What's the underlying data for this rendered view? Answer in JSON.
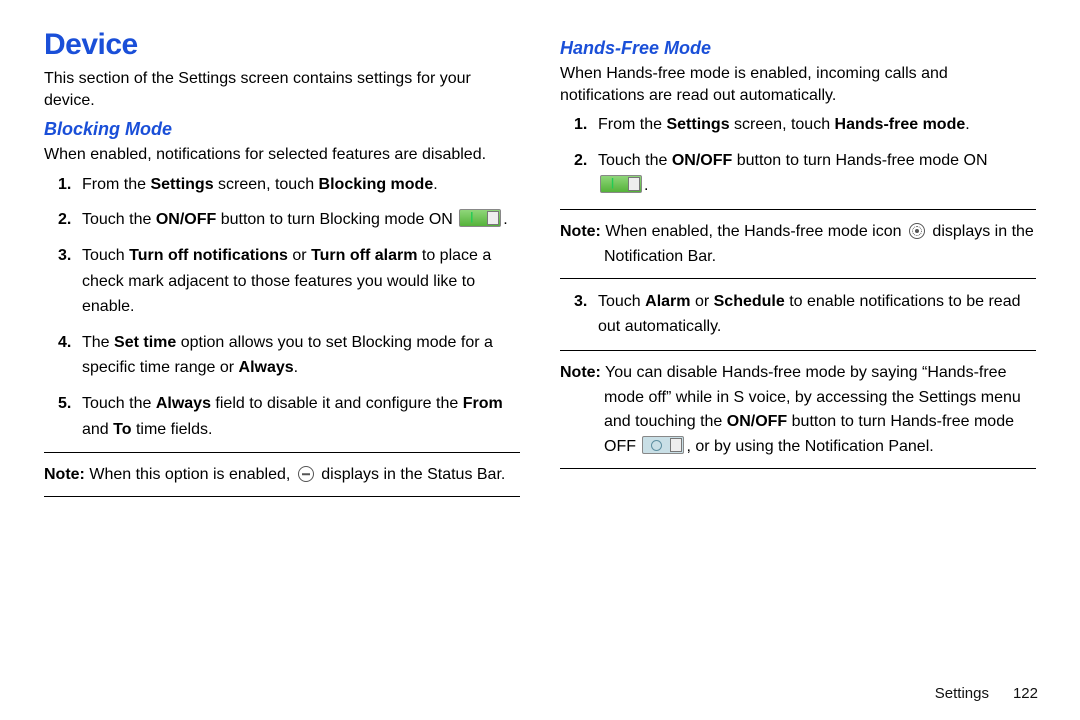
{
  "left": {
    "h1": "Device",
    "intro": "This section of the Settings screen contains settings for your device.",
    "h2": "Blocking Mode",
    "desc": "When enabled, notifications for selected features are disabled.",
    "s1a": "From the ",
    "s1b": "Settings",
    "s1c": " screen, touch ",
    "s1d": "Blocking mode",
    "s1e": ".",
    "s2a": "Touch the ",
    "s2b": "ON/OFF",
    "s2c": " button to turn Blocking mode ON ",
    "s2d": ".",
    "s3a": "Touch ",
    "s3b": "Turn off notifications",
    "s3c": " or ",
    "s3d": "Turn off alarm",
    "s3e": " to place a check mark adjacent to those features you would like to enable.",
    "s4a": "The ",
    "s4b": "Set time",
    "s4c": " option allows you to set Blocking mode for a specific time range or ",
    "s4d": "Always",
    "s4e": ".",
    "s5a": "Touch the ",
    "s5b": "Always",
    "s5c": " field to disable it and configure the ",
    "s5d": "From",
    "s5e": " and ",
    "s5f": "To",
    "s5g": " time fields.",
    "note_label": "Note:",
    "note_a": " When this option is enabled, ",
    "note_b": " displays in the Status Bar."
  },
  "right": {
    "h2": "Hands-Free Mode",
    "desc": "When Hands-free mode is enabled, incoming calls and notifications are read out automatically.",
    "s1a": "From the ",
    "s1b": "Settings",
    "s1c": " screen, touch ",
    "s1d": "Hands-free mode",
    "s1e": ".",
    "s2a": "Touch the ",
    "s2b": "ON/OFF",
    "s2c": " button to turn Hands-free mode ON ",
    "s2d": ".",
    "note1_label": "Note:",
    "note1_a": " When enabled, the Hands-free mode icon ",
    "note1_b": " displays in the Notification Bar.",
    "s3a": "Touch ",
    "s3b": "Alarm",
    "s3c": " or ",
    "s3d": "Schedule",
    "s3e": " to enable notifications to be read out automatically.",
    "note2_label": "Note:",
    "note2_a": " You can disable Hands-free mode by saying “Hands-free mode off” while in S voice, by accessing the Settings menu and touching the ",
    "note2_b": "ON/OFF",
    "note2_c": " button to turn Hands-free mode OFF ",
    "note2_d": ", or by using the Notification Panel."
  },
  "footer": {
    "section": "Settings",
    "page": "122"
  }
}
